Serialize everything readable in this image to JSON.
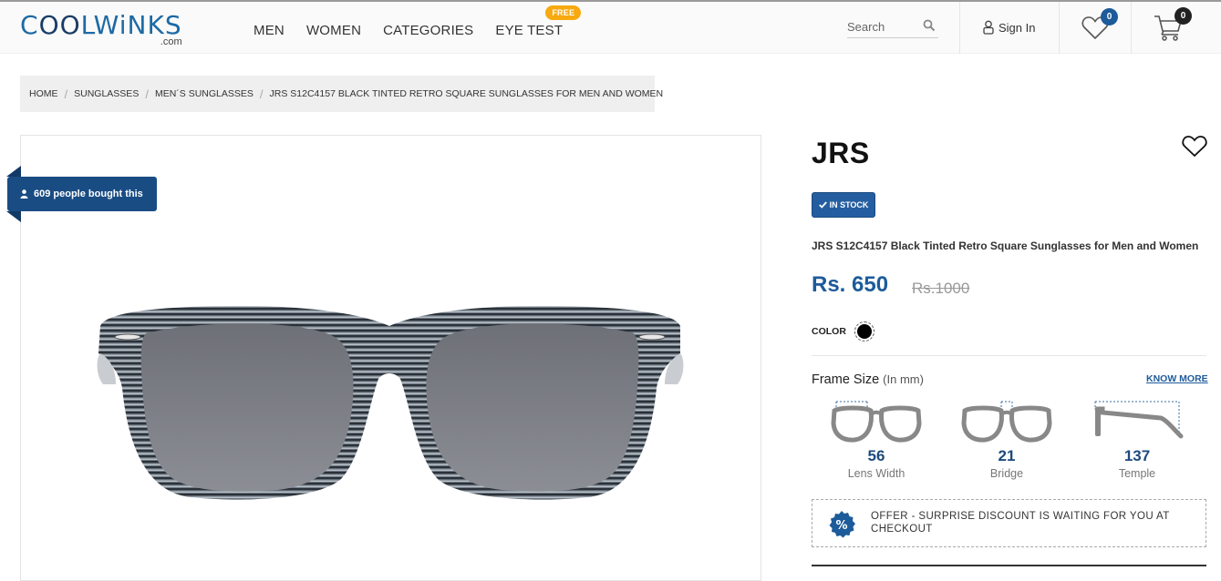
{
  "header": {
    "logo": {
      "main_a": "C",
      "main_b": "OO",
      "main_c": "LWiNKS",
      "sub": ".com"
    },
    "nav": [
      "MEN",
      "WOMEN",
      "CATEGORIES",
      "EYE TEST"
    ],
    "free_badge": "FREE",
    "search_placeholder": "Search",
    "sign_in": "Sign In",
    "wishlist_count": "0",
    "cart_count": "0"
  },
  "breadcrumb": [
    "HOME",
    "SUNGLASSES",
    "MEN´S SUNGLASSES",
    "JRS S12C4157 BLACK TINTED RETRO SQUARE SUNGLASSES FOR MEN AND WOMEN"
  ],
  "product": {
    "bought_text": "609 people bought this",
    "brand": "JRS",
    "stock": "IN STOCK",
    "name": "JRS S12C4157 Black Tinted Retro Square Sunglasses for Men and Women",
    "price": "Rs. 650",
    "mrp": "Rs.1000",
    "color_label": "COLOR",
    "color_swatch": "#000000"
  },
  "frame_size": {
    "title": "Frame Size",
    "unit": "(In mm)",
    "know_more": "KNOW MORE",
    "items": [
      {
        "value": "56",
        "label": "Lens Width"
      },
      {
        "value": "21",
        "label": "Bridge"
      },
      {
        "value": "137",
        "label": "Temple"
      }
    ]
  },
  "offer": {
    "text": "OFFER - SURPRISE DISCOUNT IS WAITING FOR YOU AT CHECKOUT"
  },
  "colors": {
    "brand_blue": "#1d5b9a",
    "badge_blue": "#1a4c84",
    "free_orange": "#f7a90f",
    "count_wish": "#1d5b9a",
    "count_cart": "#222222"
  }
}
